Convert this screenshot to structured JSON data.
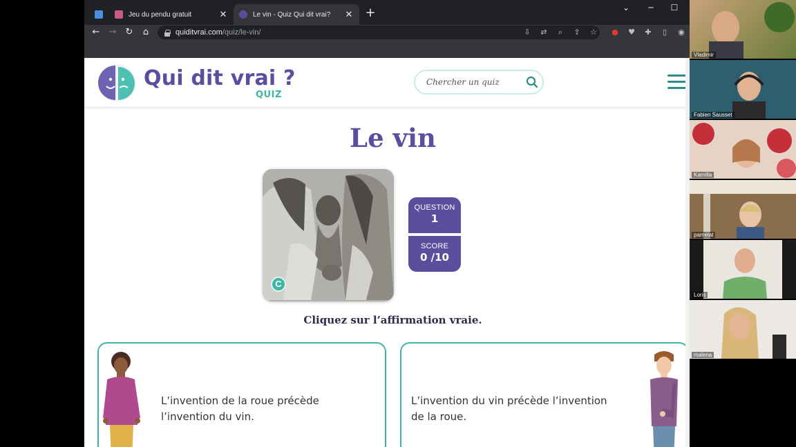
{
  "browser": {
    "tabs": [
      {
        "title": ""
      },
      {
        "title": "Jeu du pendu gratuit",
        "close": "✕"
      },
      {
        "title": "Le vin - Quiz Qui dit vrai?",
        "close": "✕"
      }
    ],
    "new_tab": "+",
    "url_host": "quiditvrai.com",
    "url_path": "/quiz/le-vin/"
  },
  "site": {
    "logo_title": "Qui dit vrai ?",
    "logo_subtitle": "QUIZ",
    "search_placeholder": "Chercher un quiz"
  },
  "quiz": {
    "title": "Le vin",
    "image_badge": "C",
    "question_label": "QUESTION",
    "question_value": "1",
    "score_label": "SCORE",
    "score_value": "0 /10",
    "instruction": "Cliquez sur l’affirmation vraie.",
    "answers": [
      {
        "text": "L’invention de la roue précède l’invention du vin."
      },
      {
        "text": "L’invention du vin précède l’invention de la roue."
      }
    ]
  },
  "participants": [
    {
      "name": "Vladimir"
    },
    {
      "name": "Fabien Sausset"
    },
    {
      "name": "Kamilla"
    },
    {
      "name": "pamelat"
    },
    {
      "name": "Loris"
    },
    {
      "name": "malena"
    }
  ],
  "colors": {
    "brand_purple": "#5b4e9e",
    "brand_teal": "#3fb5a5",
    "chrome_dark": "#202124",
    "chrome_toolbar": "#35363a"
  }
}
